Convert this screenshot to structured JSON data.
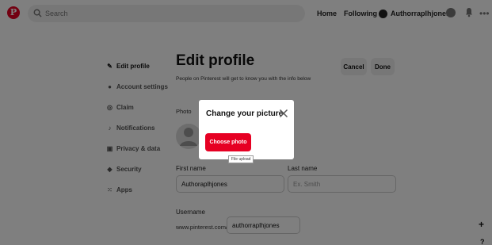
{
  "topbar": {
    "search_placeholder": "Search",
    "home": "Home",
    "following": "Following",
    "username": "Authorraplhjones"
  },
  "sidebar": {
    "items": [
      {
        "label": "Edit profile",
        "icon": "pencil-icon",
        "active": true
      },
      {
        "label": "Account settings",
        "icon": "person-icon"
      },
      {
        "label": "Claim",
        "icon": "claim-icon"
      },
      {
        "label": "Notifications",
        "icon": "bell-icon"
      },
      {
        "label": "Privacy & data",
        "icon": "lock-icon"
      },
      {
        "label": "Security",
        "icon": "shield-icon"
      },
      {
        "label": "Apps",
        "icon": "grid-icon"
      }
    ]
  },
  "main": {
    "title": "Edit profile",
    "subtitle": "People on Pinterest will get to know you with the info below",
    "cancel": "Cancel",
    "done": "Done",
    "photo_label": "Photo",
    "first_name_label": "First name",
    "first_name_value": "Authoraplhjones",
    "last_name_label": "Last name",
    "last_name_placeholder": "Ex. Smith",
    "username_label": "Username",
    "url_prefix": "www.pinterest.com/",
    "username_value": "authorraplhjones"
  },
  "modal": {
    "title": "Change your picture",
    "choose_button": "Choose photo",
    "tooltip": "File upload"
  },
  "floating": {
    "plus": "+",
    "help": "?"
  },
  "colors": {
    "brand": "#e60023",
    "overlay": "rgba(0,0,0,0.5)"
  }
}
